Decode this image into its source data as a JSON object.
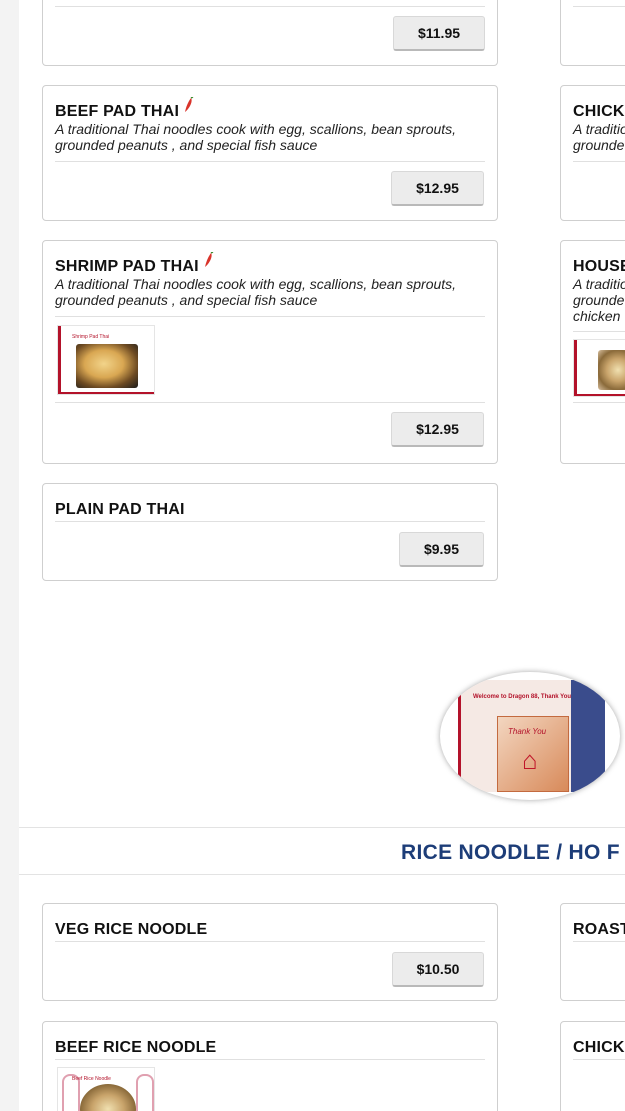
{
  "items": {
    "top_partial": {
      "price": "$11.95"
    },
    "beef_pad_thai": {
      "title": "BEEF PAD THAI",
      "desc": "A traditional Thai noodles cook with egg, scallions, bean sprouts, grounded peanuts , and special fish sauce",
      "price": "$12.95"
    },
    "shrimp_pad_thai": {
      "title": "SHRIMP PAD THAI",
      "desc": "A traditional Thai noodles cook with egg, scallions, bean sprouts, grounded peanuts , and special fish sauce",
      "price": "$12.95"
    },
    "plain_pad_thai": {
      "title": "PLAIN PAD THAI",
      "price": "$9.95"
    },
    "veg_rice_noodle": {
      "title": "VEG RICE NOODLE",
      "price": "$10.50"
    },
    "beef_rice_noodle": {
      "title": "BEEF RICE NOODLE"
    }
  },
  "right_column": {
    "chick_1": {
      "title": "CHICK",
      "desc_line1": "A traditio",
      "desc_line2": "grounde"
    },
    "house": {
      "title": "HOUSE",
      "desc_line1": "A traditio",
      "desc_line2": "grounde",
      "desc_line3": "chicken"
    },
    "roast": {
      "title": "ROAST"
    },
    "chick_2": {
      "title": "CHICK"
    }
  },
  "promo": {
    "welcome_text": "Welcome to Dragon 88, Thank You!",
    "thank_you_text": "Thank You"
  },
  "thumbs": {
    "shrimp_caption": "Shrimp Pad Thai",
    "beef_caption": "Beef Rice Noodle"
  },
  "section": {
    "title": "RICE NOODLE / HO F"
  },
  "colors": {
    "accent_red": "#b3122a",
    "section_blue": "#1d3d78",
    "chili_red": "#d9342b"
  }
}
